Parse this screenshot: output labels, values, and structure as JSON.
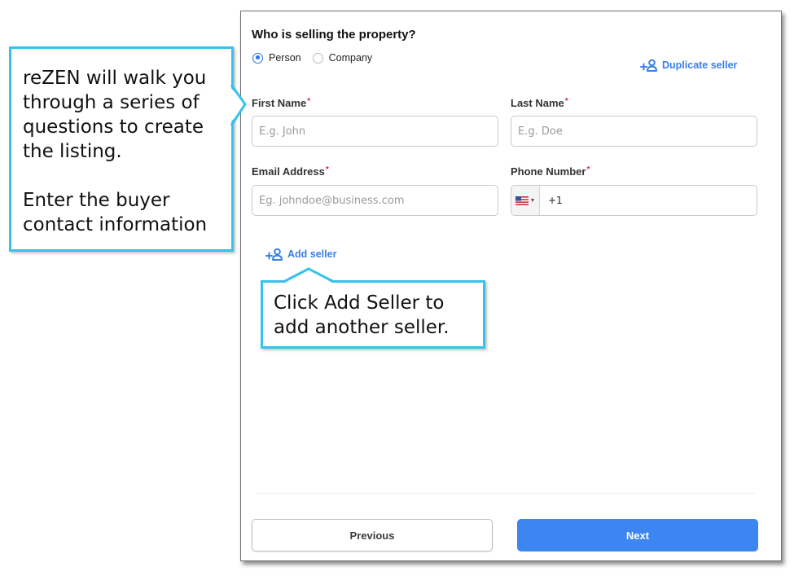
{
  "form": {
    "title": "Who is selling the property?",
    "seller_type": {
      "options": [
        "Person",
        "Company"
      ],
      "selected": "Person"
    },
    "duplicate_seller_label": "Duplicate seller",
    "first_name": {
      "label": "First Name",
      "required_mark": "*",
      "placeholder": "E.g. John",
      "value": ""
    },
    "last_name": {
      "label": "Last Name",
      "required_mark": "*",
      "placeholder": "E.g. Doe",
      "value": ""
    },
    "email": {
      "label": "Email Address",
      "required_mark": "*",
      "placeholder": "Eg. johndoe@business.com",
      "value": ""
    },
    "phone": {
      "label": "Phone Number",
      "required_mark": "*",
      "country_icon": "us-flag-icon",
      "country_code": "+1"
    },
    "add_seller_label": "Add seller",
    "previous_label": "Previous",
    "next_label": "Next"
  },
  "callouts": {
    "intro": {
      "lines": [
        "reZEN will walk you",
        "through a series of",
        "questions to create",
        "the listing."
      ],
      "lines2": [
        "Enter the buyer",
        "contact information"
      ]
    },
    "add_seller": {
      "lines": [
        "Click Add Seller to",
        "add another seller."
      ]
    }
  },
  "colors": {
    "accent": "#3d85f0",
    "link": "#3b7ee8",
    "required": "#d7263d",
    "callout_border": "#35c3ea"
  }
}
